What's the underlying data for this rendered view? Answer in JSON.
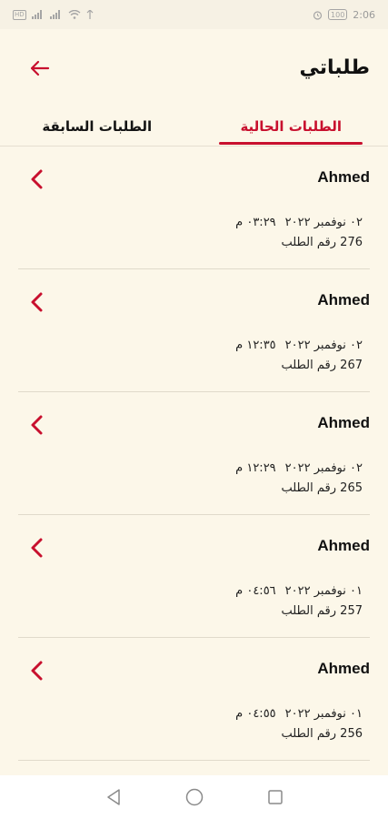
{
  "status_bar": {
    "left_chips": [
      "HD",
      "HD"
    ],
    "battery": "100",
    "time": "2:06"
  },
  "header": {
    "title": "طلباتي",
    "back_icon": "arrow-left-icon"
  },
  "tabs": [
    {
      "label": "الطلبات الحالية",
      "active": true
    },
    {
      "label": "الطلبات السابقة",
      "active": false
    }
  ],
  "orders": [
    {
      "customer": "Ahmed",
      "date": "٠٢ نوفمبر ٢٠٢٢",
      "time": "٠٣:٢٩ م",
      "number_text": "276 رقم الطلب"
    },
    {
      "customer": "Ahmed",
      "date": "٠٢ نوفمبر ٢٠٢٢",
      "time": "١٢:٣٥ م",
      "number_text": "267 رقم الطلب"
    },
    {
      "customer": "Ahmed",
      "date": "٠٢ نوفمبر ٢٠٢٢",
      "time": "١٢:٢٩ م",
      "number_text": "265 رقم الطلب"
    },
    {
      "customer": "Ahmed",
      "date": "٠١ نوفمبر ٢٠٢٢",
      "time": "٠٤:٥٦ م",
      "number_text": "257 رقم الطلب"
    },
    {
      "customer": "Ahmed",
      "date": "٠١ نوفمبر ٢٠٢٢",
      "time": "٠٤:٥٥ م",
      "number_text": "256 رقم الطلب"
    }
  ],
  "colors": {
    "accent": "#c8102e",
    "background": "#fcf7e9"
  },
  "nav": {
    "icons": [
      "back-triangle-icon",
      "home-circle-icon",
      "recents-square-icon"
    ]
  }
}
